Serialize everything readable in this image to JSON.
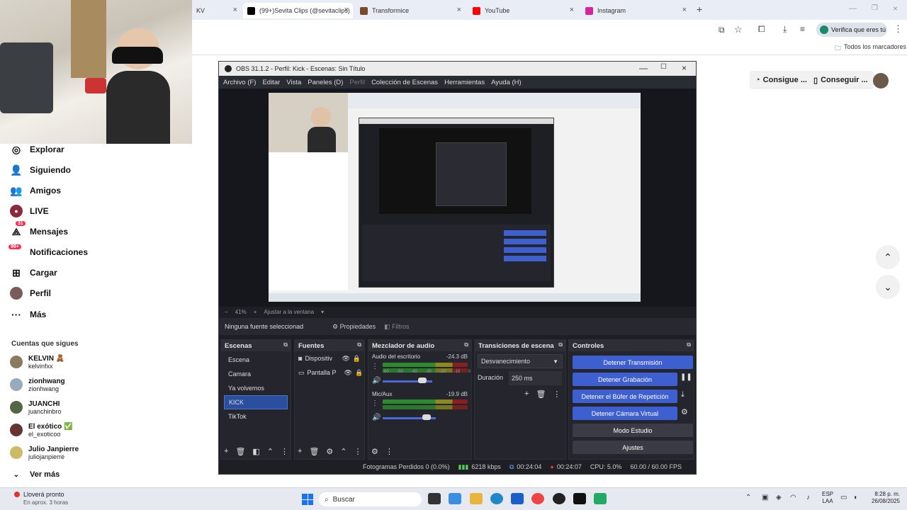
{
  "browser": {
    "tabs": [
      {
        "label": "KV"
      },
      {
        "label": "(99+)Sevita Clips (@sevitaclips)"
      },
      {
        "label": "Transformice"
      },
      {
        "label": "YouTube"
      },
      {
        "label": "Instagram"
      }
    ],
    "new_tab": "+",
    "verify_label": "Verifica que eres tú",
    "bookmarks_label": "Todos los marcadores"
  },
  "tiktok": {
    "nav": [
      {
        "label": "Explorar",
        "icon": "compass-icon"
      },
      {
        "label": "Siguiendo",
        "icon": "following-icon"
      },
      {
        "label": "Amigos",
        "icon": "friends-icon"
      },
      {
        "label": "LIVE",
        "icon": "live-icon"
      },
      {
        "label": "Mensajes",
        "icon": "messages-icon",
        "badge": "31"
      },
      {
        "label": "Notificaciones",
        "icon": "notifications-icon",
        "badge": "99+"
      },
      {
        "label": "Cargar",
        "icon": "upload-icon"
      },
      {
        "label": "Perfil",
        "icon": "profile-icon"
      },
      {
        "label": "Más",
        "icon": "more-icon"
      }
    ],
    "following_heading": "Cuentas que sigues",
    "accounts": [
      {
        "name": "KELVIN 🧸",
        "handle": "kelvinfxx"
      },
      {
        "name": "zionhwang",
        "handle": "zionhwang"
      },
      {
        "name": "JUANCHI",
        "handle": "juanchinbro"
      },
      {
        "name": "El exótico ✅",
        "handle": "el_exoticoo"
      },
      {
        "name": "Julio Janpierre",
        "handle": "juliojanpierre"
      }
    ],
    "see_more": "Ver más",
    "right_buttons": [
      "Consigue ...",
      "Conseguir ..."
    ]
  },
  "obs": {
    "title": "OBS 31.1.2 - Perfil: Kick - Escenas: Sin Título",
    "menu": [
      "Archivo (F)",
      "Editar",
      "Vista",
      "Paneles (D)",
      "Perfil",
      "Colección de Escenas",
      "Herramientas",
      "Ayuda (H)"
    ],
    "zoom": "41%",
    "fit_label": "Ajustar a la ventana",
    "no_source": "Ninguna fuente seleccionad",
    "properties": "Propiedades",
    "filters": "Filtros",
    "docks": {
      "scenes_title": "Escenas",
      "sources_title": "Fuentes",
      "mixer_title": "Mezclador de audio",
      "transitions_title": "Transiciones de escena",
      "controls_title": "Controles"
    },
    "scenes": [
      "Escena",
      "Camara",
      "Ya volvemos",
      "KICK",
      "TikTok"
    ],
    "selected_scene": "KICK",
    "sources": [
      "Dispositiv",
      "Pantalla P"
    ],
    "mixer": [
      {
        "name": "Audio del escritorio",
        "db": "-24.3 dB",
        "level": 0.62,
        "volume": 0.85
      },
      {
        "name": "Mic/Aux",
        "db": "-19.9 dB",
        "level": 0.7,
        "volume": 0.9
      }
    ],
    "meter_ticks": [
      "-60",
      "-55",
      "-50",
      "-45",
      "-40",
      "-35",
      "-30",
      "-25",
      "-20",
      "-15",
      "-10",
      "-5",
      "0"
    ],
    "transition": "Desvanecimiento",
    "duration_label": "Duración",
    "duration_value": "250 ms",
    "controls": [
      "Detener Transmisión",
      "Detener Grabación",
      "Detener el Búfer de Repetición",
      "Detener Cámara Virtual",
      "Modo Estudio",
      "Ajustes"
    ],
    "status": {
      "dropped": "Fotogramas Perdidos 0 (0.0%)",
      "bitrate": "6218 kbps",
      "stream_time": "00:24:04",
      "rec_time": "00:24:07",
      "cpu": "CPU: 5.0%",
      "fps": "60.00 / 60.00 FPS"
    }
  },
  "taskbar": {
    "weather": "Lloverá pronto",
    "weather_sub": "En aprox. 3 horas",
    "search": "Buscar",
    "lang": "ESP",
    "lang2": "LAA",
    "time": "8:28 p. m.",
    "date": "26/08/2025"
  },
  "colors": {
    "obs_accent": "#3e5fcf",
    "obs_bg": "#1e1f25",
    "tiktok_badge": "#fe2c55"
  }
}
